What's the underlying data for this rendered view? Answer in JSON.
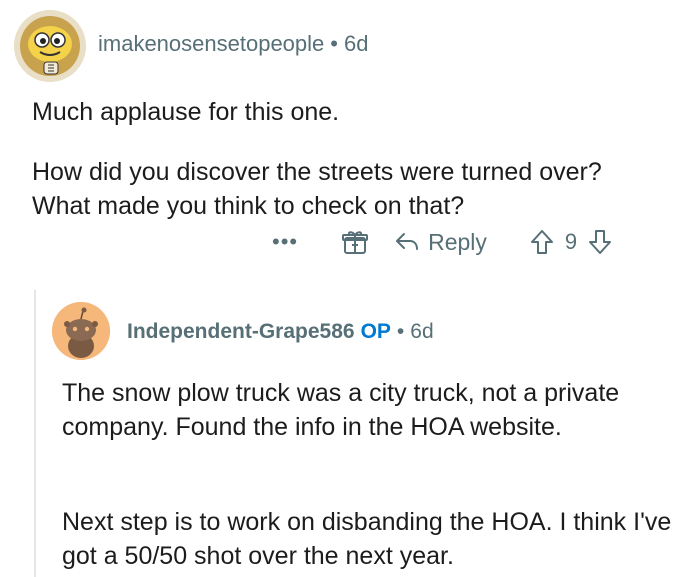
{
  "comment": {
    "username": "imakenosensetopeople",
    "separator": "•",
    "age": "6d",
    "paragraphs": [
      "Much applause for this one.",
      "How did you discover the streets were turned over? What made you think to check on that?"
    ],
    "actions": {
      "more": "•••",
      "reply_label": "Reply",
      "vote_count": "9"
    }
  },
  "reply": {
    "username": "Independent-Grape586",
    "op_badge": "OP",
    "separator": "•",
    "age": "6d",
    "paragraphs": [
      "The snow plow truck was a city truck, not a private company.  Found the info in the HOA website.",
      "Next step is to work on disbanding the HOA.  I think I've got a 50/50 shot over the next year."
    ]
  },
  "icons": {
    "avatar1": "user-avatar-icon",
    "avatar2": "snoo-avatar-icon",
    "more": "more-options-icon",
    "award": "award-gift-icon",
    "reply": "reply-arrow-icon",
    "upvote": "upvote-arrow-icon",
    "downvote": "downvote-arrow-icon"
  },
  "colors": {
    "meta_gray": "#576f76",
    "op_blue": "#0079d3",
    "text": "#1c1c1c"
  }
}
